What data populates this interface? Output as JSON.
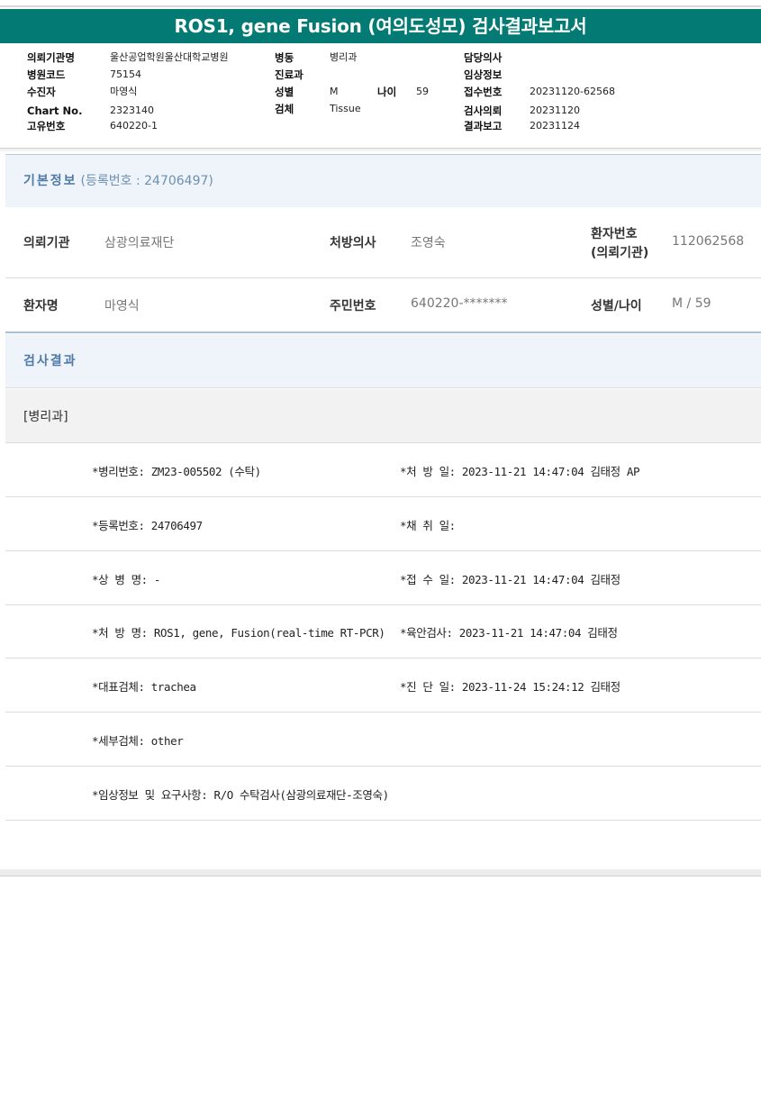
{
  "title": "ROS1, gene Fusion (여의도성모) 검사결과보고서",
  "header": {
    "institution_label": "의뢰기관명",
    "institution": "울산공업학원울산대학교병원",
    "hospital_code_label": "병원코드",
    "hospital_code": "75154",
    "patient_label": "수진자",
    "patient": "마영식",
    "chart_label": "Chart No.",
    "chart_no": "2323140",
    "id_label": "고유번호",
    "id_no": "640220-1",
    "ward_label": "병동",
    "ward": "병리과",
    "dept_label": "진료과",
    "dept": "",
    "sex_label": "성별",
    "sex": "M",
    "age_label": "나이",
    "age": "59",
    "specimen_label": "검체",
    "specimen": "Tissue",
    "doctor_label": "담당의사",
    "doctor": "",
    "clinical_label": "임상정보",
    "clinical": "",
    "receipt_label": "접수번호",
    "receipt": "20231120-62568",
    "request_label": "검사의뢰",
    "request": "20231120",
    "report_label": "결과보고",
    "report": "20231124"
  },
  "basic": {
    "heading": "기본정보",
    "reg_text": "(등록번호 : 24706497)",
    "inst_label": "의뢰기관",
    "inst": "삼광의료재단",
    "doc_label": "처방의사",
    "doc": "조영숙",
    "pno_label_1": "환자번호",
    "pno_label_2": "(의뢰기관)",
    "pno": "112062568",
    "name_label": "환자명",
    "name": "마영식",
    "rrn_label": "주민번호",
    "rrn": "640220-*******",
    "sexage_label": "성별/나이",
    "sexage": "M / 59"
  },
  "results": {
    "heading": "검사결과",
    "category": "[병리과]",
    "rows": [
      {
        "left": "*병리번호: ZM23-005502 (수탁)",
        "right": "*처 방 일: 2023-11-21 14:47:04  김태정 AP"
      },
      {
        "left": "*등록번호: 24706497",
        "right": "*채 취 일:"
      },
      {
        "left": "*상 병 명: -",
        "right": "*접 수 일: 2023-11-21 14:47:04  김태정"
      },
      {
        "left": "*처 방 명: ROS1, gene, Fusion(real-time RT-PCR)",
        "right": "*육안검사: 2023-11-21 14:47:04  김태정"
      },
      {
        "left": "*대표검체: trachea",
        "right": "*진 단 일: 2023-11-24 15:24:12  김태정"
      },
      {
        "left": "*세부검체: other",
        "right": ""
      },
      {
        "left": "*임상정보 및 요구사항: R/O 수탁검사(삼광의료재단-조영숙)",
        "right": ""
      }
    ]
  },
  "colors": {
    "title_bg": "#037a74",
    "section_text": "#4f79a9",
    "section_bg": "#eef4f9"
  }
}
